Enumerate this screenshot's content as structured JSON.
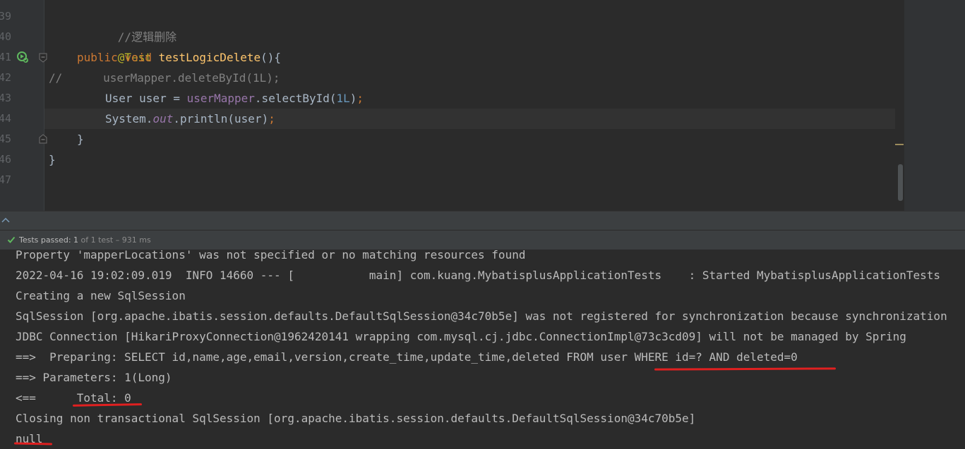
{
  "gutter": {
    "line_numbers": [
      "39",
      "40",
      "41",
      "42",
      "43",
      "44",
      "45",
      "46",
      "47"
    ]
  },
  "code": {
    "l1_comment": "//逻辑删除",
    "l2_annotation": "@Test",
    "l3_kw_public": "public",
    "l3_kw_void": "void",
    "l3_method": "testLogicDelete",
    "l3_rest": "(){",
    "l4_prefix": "//",
    "l4_body": "userMapper.deleteById(1L);",
    "l5_type": "User user = ",
    "l5_field": "userMapper",
    "l5_call": ".selectById(",
    "l5_num": "1L",
    "l5_close": ")",
    "l5_semi": ";",
    "l6_system": "System.",
    "l6_out": "out",
    "l6_call": ".println(user)",
    "l6_semi": ";",
    "l7_brace": "}",
    "l8_brace": "}"
  },
  "status": {
    "passed_label": "Tests passed: ",
    "passed_count": "1",
    "of_text": " of 1 test",
    "duration": " – 931 ms"
  },
  "console": {
    "lines": [
      "Property 'mapperLocations' was not specified or no matching resources found",
      "2022-04-16 19:02:09.019  INFO 14660 --- [           main] com.kuang.MybatisplusApplicationTests    : Started MybatisplusApplicationTests",
      "Creating a new SqlSession",
      "SqlSession [org.apache.ibatis.session.defaults.DefaultSqlSession@34c70b5e] was not registered for synchronization because synchronization",
      "JDBC Connection [HikariProxyConnection@1962420141 wrapping com.mysql.cj.jdbc.ConnectionImpl@73c3cd09] will not be managed by Spring",
      "==>  Preparing: SELECT id,name,age,email,version,create_time,update_time,deleted FROM user WHERE id=? AND deleted=0",
      "==> Parameters: 1(Long)",
      "<==      Total: 0",
      "Closing non transactional SqlSession [org.apache.ibatis.session.defaults.DefaultSqlSession@34c70b5e]",
      "null"
    ]
  },
  "colors": {
    "annotation_underline": "#e02020",
    "pass_green": "#5fb85f"
  }
}
